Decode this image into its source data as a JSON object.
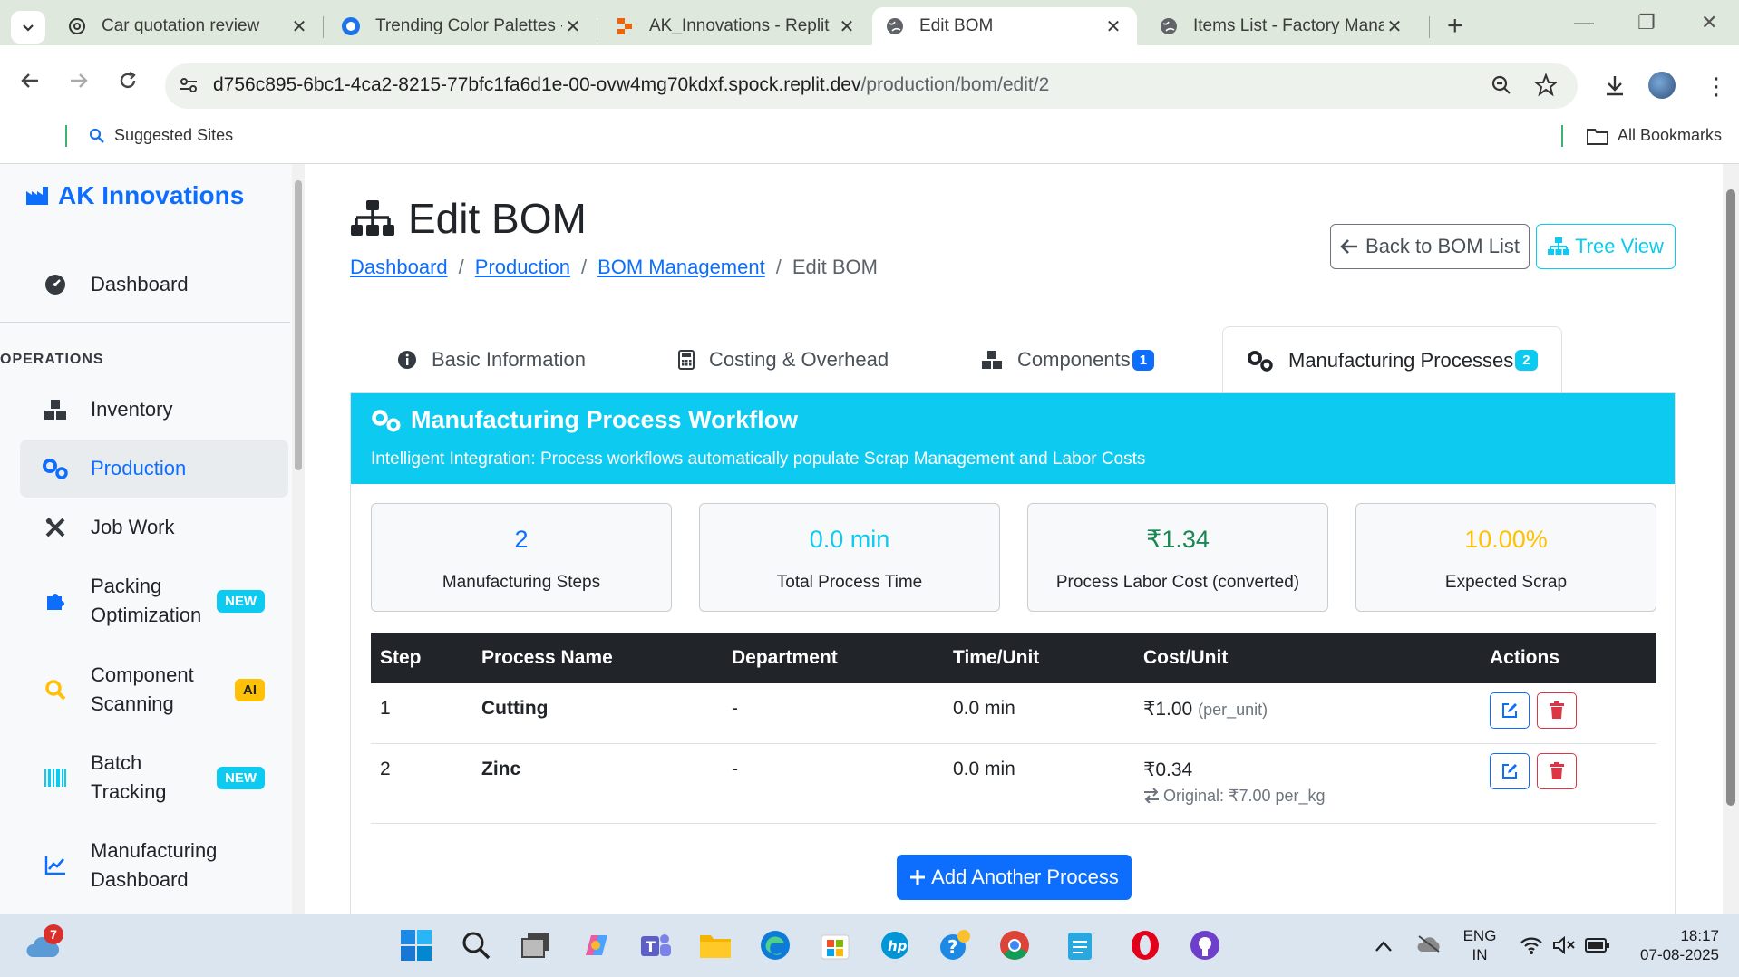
{
  "browser": {
    "tabs": [
      {
        "title": "Car quotation review",
        "icon": "openai-icon"
      },
      {
        "title": "Trending Color Palettes -",
        "icon": "coolors-icon"
      },
      {
        "title": "AK_Innovations - Replit",
        "icon": "replit-icon"
      },
      {
        "title": "Edit BOM",
        "icon": "globe-icon",
        "active": true
      },
      {
        "title": "Items List - Factory Mana",
        "icon": "globe-icon"
      }
    ],
    "url_host": "d756c895-6bc1-4ca2-8215-77bfc1fa6d1e-00-ovw4mg70kdxf.spock.replit.dev",
    "url_path": "/production/bom/edit/2",
    "bookmarks": {
      "suggested": "Suggested Sites",
      "all": "All Bookmarks"
    }
  },
  "sidebar": {
    "brand": "AK Innovations",
    "dashboard": "Dashboard",
    "section_heading": "OPERATIONS",
    "items": [
      {
        "label": "Inventory"
      },
      {
        "label": "Production"
      },
      {
        "label": "Job Work"
      },
      {
        "label": "Packing Optimization",
        "line1": "Packing",
        "line2": "Optimization",
        "badge": "NEW"
      },
      {
        "label": "Component Scanning",
        "line1": "Component",
        "line2": "Scanning",
        "badge": "AI"
      },
      {
        "label": "Batch Tracking",
        "line1": "Batch",
        "line2": "Tracking",
        "badge": "NEW"
      },
      {
        "label": "Manufacturing Dashboard",
        "line1": "Manufacturing",
        "line2": "Dashboard"
      }
    ]
  },
  "page": {
    "title": "Edit BOM",
    "breadcrumb": [
      "Dashboard",
      "Production",
      "BOM Management",
      "Edit BOM"
    ],
    "back_button": "Back to BOM List",
    "tree_button": "Tree View",
    "tabs": [
      {
        "label": "Basic Information"
      },
      {
        "label": "Costing & Overhead"
      },
      {
        "label": "Components",
        "badge": "1"
      },
      {
        "label": "Manufacturing Processes",
        "badge": "2"
      }
    ]
  },
  "workflow": {
    "title": "Manufacturing Process Workflow",
    "subtitle": "Intelligent Integration: Process workflows automatically populate Scrap Management and Labor Costs",
    "stats": [
      {
        "value": "2",
        "label": "Manufacturing Steps",
        "color": "#0d6efd"
      },
      {
        "value": "0.0 min",
        "label": "Total Process Time",
        "color": "#0dcaf0"
      },
      {
        "value": "₹1.34",
        "label": "Process Labor Cost (converted)",
        "color": "#198754"
      },
      {
        "value": "10.00%",
        "label": "Expected Scrap",
        "color": "#ffc107"
      }
    ],
    "table": {
      "headers": [
        "Step",
        "Process Name",
        "Department",
        "Time/Unit",
        "Cost/Unit",
        "Actions"
      ],
      "rows": [
        {
          "step": "1",
          "name": "Cutting",
          "department": "-",
          "time": "0.0 min",
          "cost": "₹1.00",
          "unit": "(per_unit)",
          "original": ""
        },
        {
          "step": "2",
          "name": "Zinc",
          "department": "-",
          "time": "0.0 min",
          "cost": "₹0.34",
          "unit": "",
          "original": "Original: ₹7.00 per_kg"
        }
      ]
    },
    "add_button": "Add Another Process"
  },
  "taskbar": {
    "weather_badge": "7",
    "lang_line1": "ENG",
    "lang_line2": "IN",
    "time": "18:17",
    "date": "07-08-2025"
  },
  "colors": {
    "primary": "#0d6efd",
    "info": "#0dcaf0",
    "success": "#198754",
    "warning": "#ffc107",
    "danger": "#dc3545",
    "dark": "#212529"
  }
}
